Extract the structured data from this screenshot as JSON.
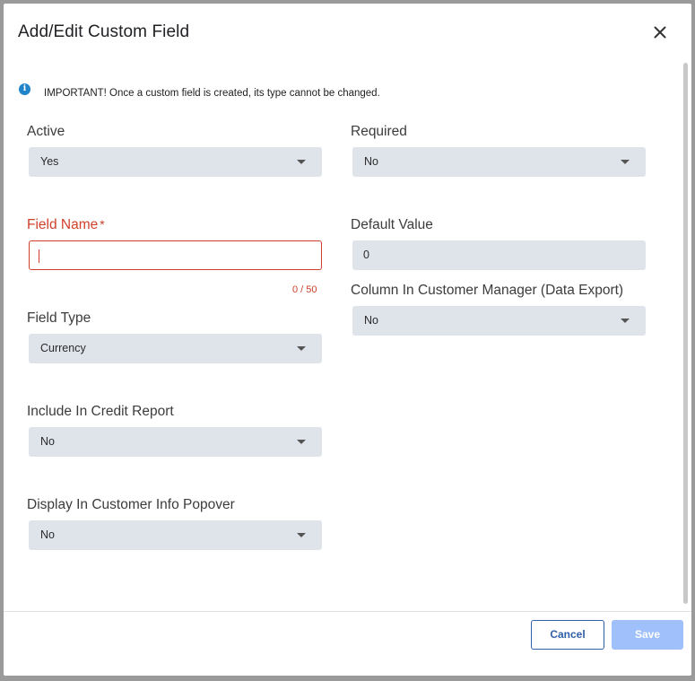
{
  "dialog": {
    "title": "Add/Edit Custom Field",
    "close_icon": "close-icon"
  },
  "notice": {
    "icon": "info-icon",
    "icon_glyph": "i",
    "text": "IMPORTANT! Once a custom field is created, its type cannot be changed."
  },
  "fields": {
    "active": {
      "label": "Active",
      "value": "Yes"
    },
    "required": {
      "label": "Required",
      "value": "No"
    },
    "field_name": {
      "label": "Field Name",
      "required_mark": "*",
      "value": "",
      "counter": "0 / 50"
    },
    "default_value": {
      "label": "Default Value",
      "value": "0"
    },
    "column_in_customer_manager": {
      "label": "Column In Customer Manager (Data Export)",
      "value": "No"
    },
    "field_type": {
      "label": "Field Type",
      "value": "Currency"
    },
    "include_in_credit_report": {
      "label": "Include In Credit Report",
      "value": "No"
    },
    "display_in_customer_info_popover": {
      "label": "Display In Customer Info Popover",
      "value": "No"
    }
  },
  "footer": {
    "cancel_label": "Cancel",
    "save_label": "Save"
  },
  "colors": {
    "error": "#d0402a",
    "primary": "#2f5fa8",
    "save_disabled": "#9fc0fb",
    "field_bg": "#dfe3ea",
    "info": "#1f84c9"
  }
}
